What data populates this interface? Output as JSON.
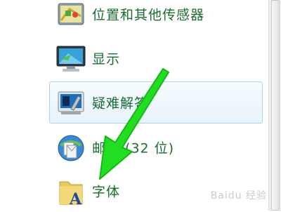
{
  "items": [
    {
      "label": "位置和其他传感器",
      "icon": "location-sensor-icon"
    },
    {
      "label": "显示",
      "icon": "display-monitor-icon"
    },
    {
      "label": "疑难解答",
      "icon": "troubleshooting-icon"
    },
    {
      "label": "邮件 (32 位)",
      "icon": "mail-icon"
    },
    {
      "label": "字体",
      "icon": "fonts-folder-icon"
    }
  ],
  "overlay": {
    "arrow_color": "#22dd22",
    "arrow": "green-arrow-annotation"
  },
  "watermark": "Baidu 经验",
  "colors": {
    "label_text": "#1d6b32",
    "hover_border": "#a9d3ee"
  }
}
